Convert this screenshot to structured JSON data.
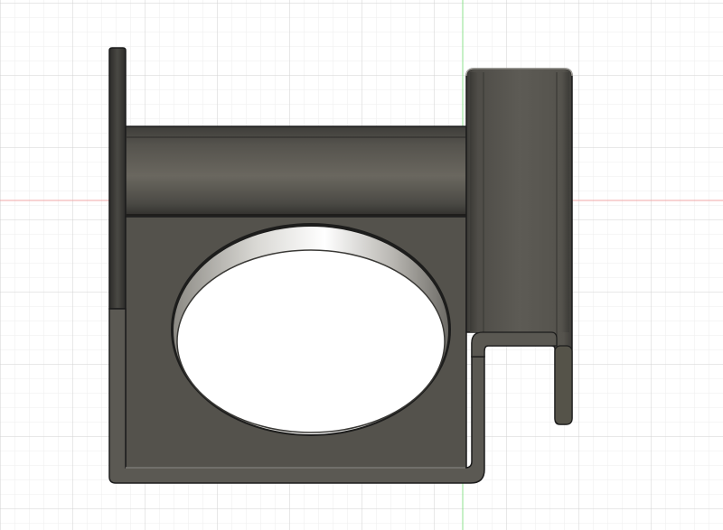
{
  "viewport": {
    "background": "#ffffff",
    "grid_minor_color": "#ededed",
    "grid_major_color": "#d2d2d2",
    "axis_x_color": "#f0a7a7",
    "axis_y_color": "#8ee08e"
  },
  "model": {
    "name": "bracket-with-circular-cutout",
    "body_color": "#54524c",
    "highlight_color": "#b5b2aa",
    "edge_color": "#1c1c1c"
  }
}
